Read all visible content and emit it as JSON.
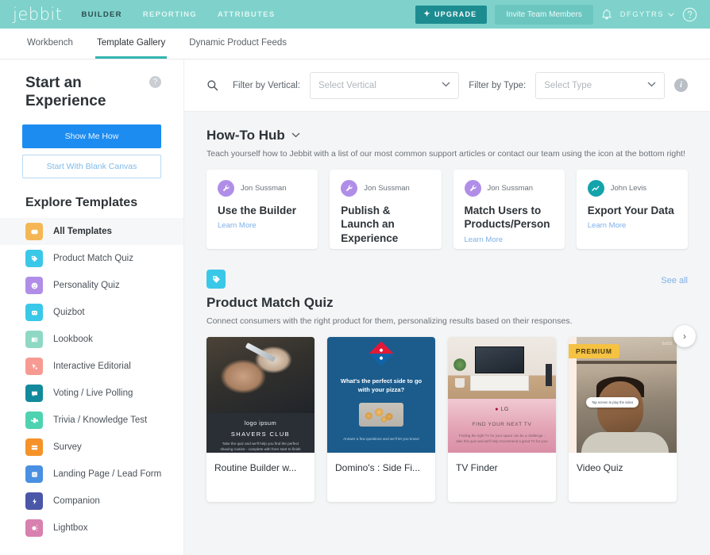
{
  "header": {
    "logo": "jebbit",
    "nav": [
      {
        "label": "BUILDER",
        "active": true
      },
      {
        "label": "REPORTING",
        "active": false
      },
      {
        "label": "ATTRIBUTES",
        "active": false
      }
    ],
    "upgrade_label": "UPGRADE",
    "invite_label": "Invite Team Members",
    "account_label": "DFGYTRS",
    "bell_icon": "bell-icon",
    "help_icon": "help-circle-icon",
    "accent": "#7ed2cb",
    "upgrade_color": "#1d8c91"
  },
  "subnav": {
    "tabs": [
      {
        "label": "Workbench",
        "active": false
      },
      {
        "label": "Template Gallery",
        "active": true
      },
      {
        "label": "Dynamic Product Feeds",
        "active": false
      }
    ],
    "active_underline": "#34b6b0"
  },
  "sidebar": {
    "title": "Start an Experience",
    "help_icon": "question-mark-icon",
    "show_me_how": "Show Me How",
    "blank_canvas": "Start With Blank Canvas",
    "explore_title": "Explore Templates",
    "items": [
      {
        "label": "All Templates",
        "icon": "grid-icon",
        "color": "#f5b755",
        "selected": true
      },
      {
        "label": "Product Match Quiz",
        "icon": "tag-icon",
        "color": "#3ac8e8",
        "selected": false
      },
      {
        "label": "Personality Quiz",
        "icon": "smiley-icon",
        "color": "#b08ee8",
        "selected": false
      },
      {
        "label": "Quizbot",
        "icon": "robot-icon",
        "color": "#3ac8e8",
        "selected": false
      },
      {
        "label": "Lookbook",
        "icon": "book-icon",
        "color": "#8fd9c4",
        "selected": false
      },
      {
        "label": "Interactive Editorial",
        "icon": "cursor-icon",
        "color": "#f79a92",
        "selected": false
      },
      {
        "label": "Voting / Live Polling",
        "icon": "comment-icon",
        "color": "#128a9c",
        "selected": false
      },
      {
        "label": "Trivia / Knowledge Test",
        "icon": "puzzle-icon",
        "color": "#4fd2b0",
        "selected": false
      },
      {
        "label": "Survey",
        "icon": "list-icon",
        "color": "#f5932a",
        "selected": false
      },
      {
        "label": "Landing Page / Lead Form",
        "icon": "form-icon",
        "color": "#4a90e2",
        "selected": false
      },
      {
        "label": "Companion",
        "icon": "bolt-icon",
        "color": "#4a56a8",
        "selected": false
      },
      {
        "label": "Lightbox",
        "icon": "bulb-icon",
        "color": "#d880ae",
        "selected": false
      }
    ]
  },
  "filterbar": {
    "search_icon": "search-icon",
    "vertical_label": "Filter by Vertical:",
    "vertical_placeholder": "Select Vertical",
    "type_label": "Filter by Type:",
    "type_placeholder": "Select Type",
    "info_icon": "info-icon"
  },
  "howto": {
    "title": "How-To Hub",
    "chevron": "chevron-down-icon",
    "subtitle": "Teach yourself how to Jebbit with a list of our most common support articles or contact our team using the icon at the bottom right!",
    "cards": [
      {
        "author": "Jon Sussman",
        "title": "Use the Builder",
        "link": "Learn More",
        "avatar_icon": "wrench-icon",
        "avatar_color": "#b08ee8"
      },
      {
        "author": "Jon Sussman",
        "title": "Publish & Launch an Experience",
        "link": "",
        "avatar_icon": "wrench-icon",
        "avatar_color": "#b08ee8"
      },
      {
        "author": "Jon Sussman",
        "title": "Match Users to Products/Person",
        "link": "Learn More",
        "avatar_icon": "wrench-icon",
        "avatar_color": "#b08ee8"
      },
      {
        "author": "John Levis",
        "title": "Export Your Data",
        "link": "Learn More",
        "avatar_icon": "trend-chart-icon",
        "avatar_color": "#13a3ab"
      }
    ]
  },
  "product_match": {
    "badge_icon": "tag-icon",
    "badge_color": "#3ac8e8",
    "see_all": "See all",
    "title": "Product Match Quiz",
    "subtitle": "Connect consumers with the right product for them, personalizing results based on their responses.",
    "next_arrow": "chevron-right-icon",
    "templates": [
      {
        "name": "Routine Builder w...",
        "thumb": "shavers-club",
        "premium": false,
        "thumb_logo": "logo ipsum",
        "thumb_heading": "SHAVERS CLUB",
        "thumb_body": "Take the quiz and we'll help you find the perfect shaving routine - complete with from start to finish"
      },
      {
        "name": "Domino's : Side Fi...",
        "thumb": "dominos",
        "premium": false,
        "thumb_heading": "What's the perfect side to go with your pizza?",
        "thumb_body": "Answer a few questions and we'll let you know!"
      },
      {
        "name": "TV Finder",
        "thumb": "tv-finder",
        "premium": false,
        "thumb_logo": "LG",
        "thumb_heading": "FIND YOUR NEXT TV",
        "thumb_body": "Finding the right TV for your space can be a challenge - take this quiz and we'll help recommend a great TV for you!"
      },
      {
        "name": "Video Quiz",
        "thumb": "video-quiz",
        "premium": true,
        "premium_label": "PREMIUM",
        "thumb_body": "Tap screen to play the video",
        "thumb_timer": "0of10"
      }
    ]
  }
}
